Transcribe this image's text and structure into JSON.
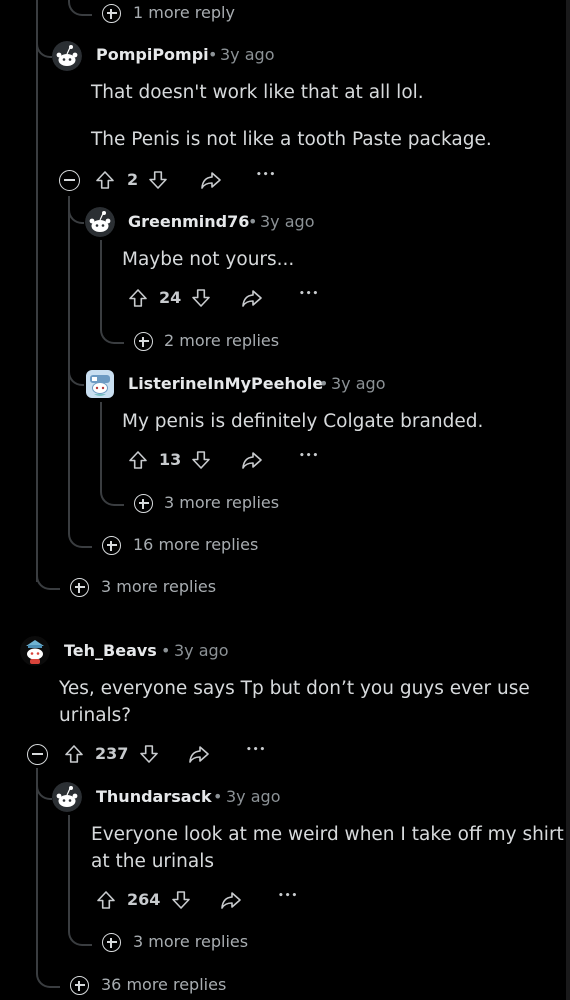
{
  "thread": {
    "top_more_reply": "1 more reply",
    "c1": {
      "author": "PompiPompi",
      "age": "3y ago",
      "text_p1": "That doesn't work like that at all lol.",
      "text_p2": "The Penis is not like a tooth Paste package.",
      "score": "2"
    },
    "c2": {
      "author": "Greenmind76",
      "age": "3y ago",
      "text": "Maybe not yours...",
      "score": "24",
      "more": "2 more replies"
    },
    "c3": {
      "author": "ListerineInMyPeehole",
      "age": "3y ago",
      "text": "My penis is definitely Colgate branded.",
      "score": "13",
      "more": "3 more replies"
    },
    "more_16": "16 more replies",
    "more_3": "3 more replies",
    "c4": {
      "author": "Teh_Beavs",
      "age": "3y ago",
      "text_l1": "Yes, everyone says Tp but don’t you guys ever use",
      "text_l2": "urinals?",
      "score": "237"
    },
    "c5": {
      "author": "Thundarsack",
      "age": "3y ago",
      "text_l1": "Everyone look at me weird when I take off my shirt",
      "text_l2": "at the urinals",
      "score": "264",
      "more": "3 more replies"
    },
    "more_36": "36 more replies"
  },
  "ui": {
    "separator": "•",
    "overflow": "•••"
  },
  "icons": [
    "upvote-icon",
    "downvote-icon",
    "share-icon",
    "overflow-icon",
    "expand-icon",
    "collapse-icon",
    "avatar-icon"
  ],
  "colors": {
    "background": "#000000",
    "text": "#d7dadc",
    "muted": "#8c9296",
    "thread_line": "#3a3d40"
  }
}
